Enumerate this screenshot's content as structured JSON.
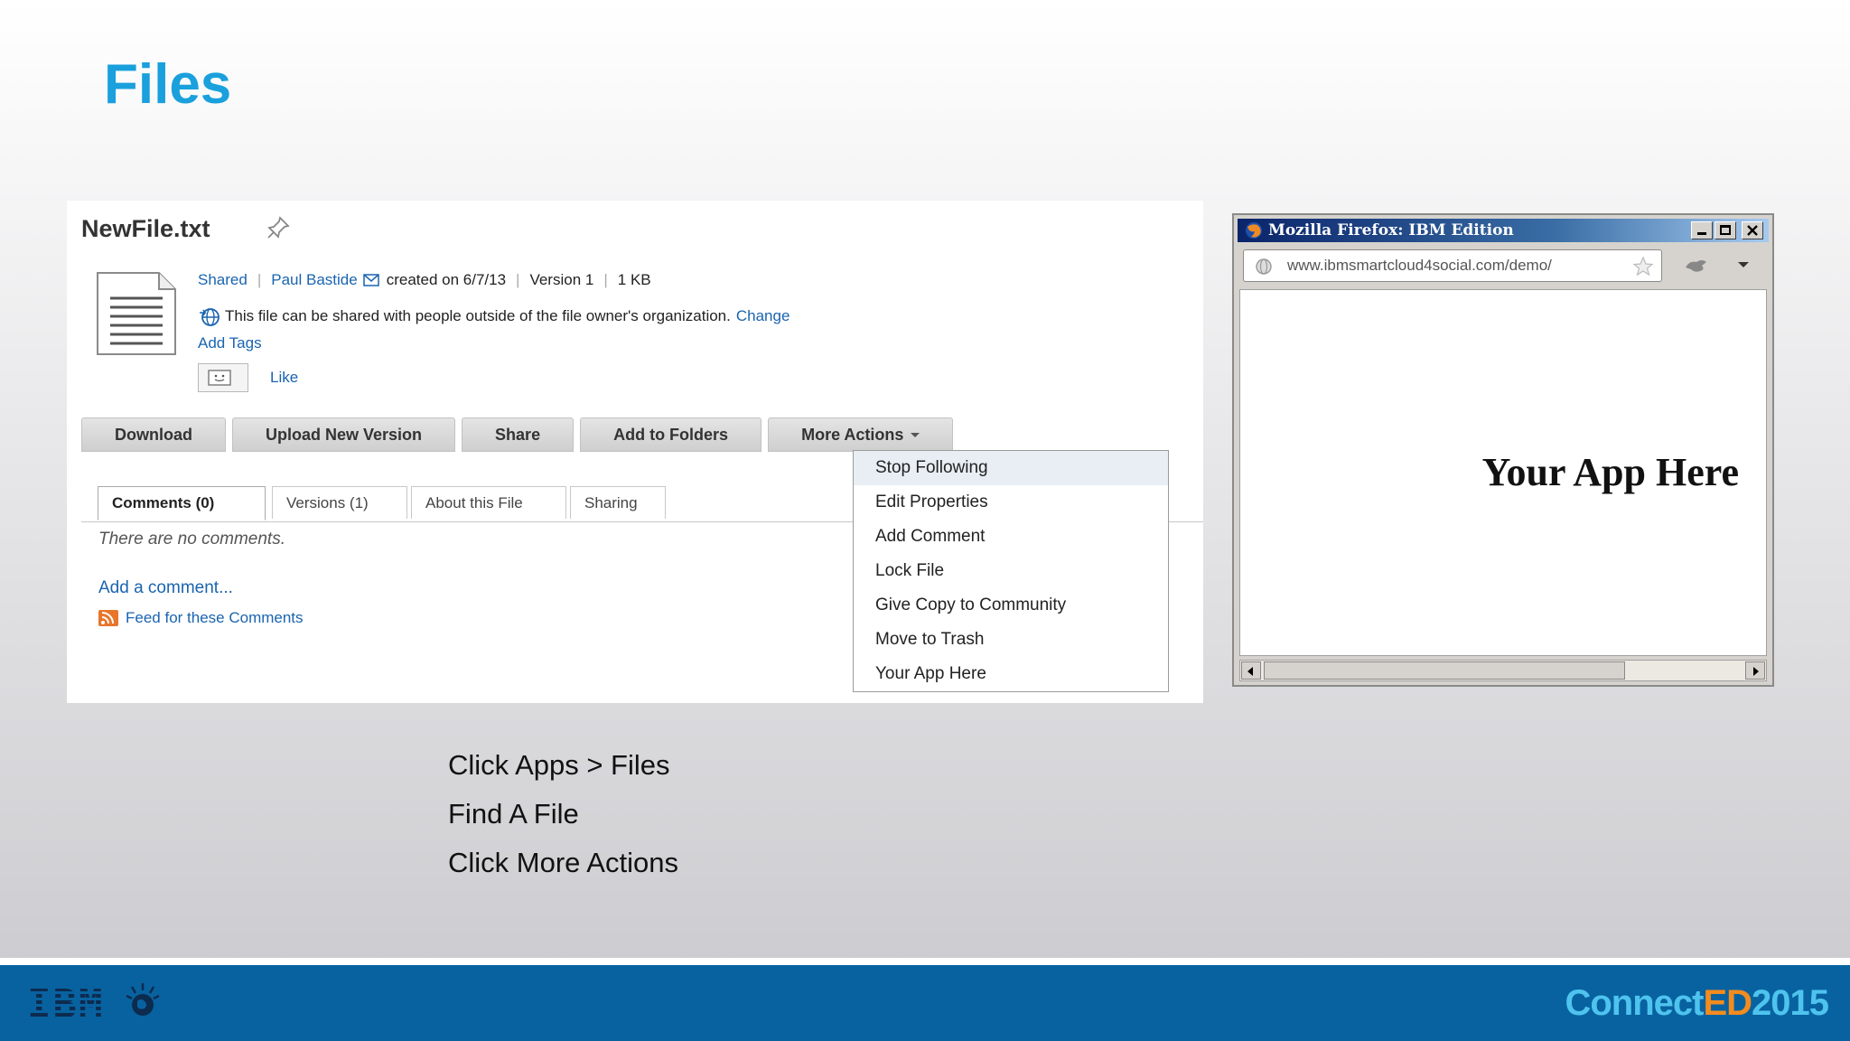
{
  "slide": {
    "title": "Files"
  },
  "file": {
    "name": "NewFile.txt",
    "shared_label": "Shared",
    "owner": "Paul Bastide",
    "created": "created on 6/7/13",
    "version": "Version 1",
    "size": "1 KB",
    "share_notice": "This file can be shared with people outside of the file owner's organization.",
    "change_link": "Change",
    "add_tags": "Add Tags",
    "like": "Like"
  },
  "actions": {
    "download": "Download",
    "upload": "Upload New Version",
    "share": "Share",
    "add_to_folders": "Add to Folders",
    "more_actions": "More Actions"
  },
  "tabs": [
    {
      "label": "Comments (0)"
    },
    {
      "label": "Versions (1)"
    },
    {
      "label": "About this File"
    },
    {
      "label": "Sharing"
    }
  ],
  "comments": {
    "empty": "There are no comments.",
    "add": "Add a comment...",
    "feed": "Feed for these Comments"
  },
  "more_actions_menu": [
    {
      "label": "Stop Following"
    },
    {
      "label": "Edit Properties"
    },
    {
      "label": "Add Comment"
    },
    {
      "label": "Lock File"
    },
    {
      "label": "Give Copy to Community"
    },
    {
      "label": "Move to Trash"
    },
    {
      "label": "Your App Here"
    }
  ],
  "browser": {
    "title": "Mozilla Firefox: IBM Edition",
    "url": "www.ibmsmartcloud4social.com/demo/",
    "content_text": "Your App Here"
  },
  "instructions": [
    "Click Apps > Files",
    "Find A File",
    "Click More Actions"
  ],
  "footer": {
    "ibm_logo": "IBM",
    "brand_part1": "Connect",
    "brand_part2": "ED",
    "brand_part3": "2015"
  },
  "colors": {
    "title_blue": "#1aa0dc",
    "link_blue": "#1a64b0",
    "footer_blue": "#0862a0",
    "brand_cyan": "#4ec3ee",
    "brand_orange": "#f28c1e"
  }
}
